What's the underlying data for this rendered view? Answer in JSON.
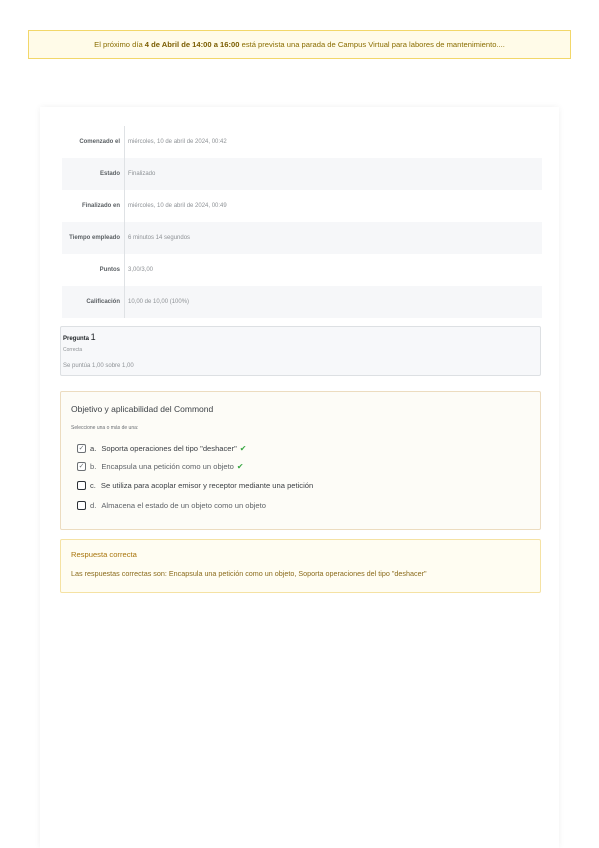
{
  "notice": {
    "pre": "El próximo día ",
    "bold": "4 de Abril de 14:00 a 16:00",
    "post": " está prevista una parada de Campus Virtual para labores de mantenimiento...."
  },
  "summary": [
    {
      "label": "Comenzado el",
      "value": "miércoles, 10 de abril de 2024, 00:42"
    },
    {
      "label": "Estado",
      "value": "Finalizado"
    },
    {
      "label": "Finalizado en",
      "value": "miércoles, 10 de abril de 2024, 00:49"
    },
    {
      "label": "Tiempo empleado",
      "value": "6 minutos 14 segundos"
    },
    {
      "label": "Puntos",
      "value": "3,00/3,00"
    },
    {
      "label": "Calificación",
      "value": "10,00 de 10,00 (100%)"
    }
  ],
  "question": {
    "title_prefix": "Pregunta ",
    "number": "1",
    "state": "Correcta",
    "grade": "Se puntúa 1,00 sobre 1,00",
    "text": "Objetivo y aplicabilidad del Commond",
    "prompt": "Seleccione una o más de una:",
    "options": [
      {
        "letter": "a.",
        "text": "Soporta operaciones del tipo \"deshacer\"",
        "checked": true,
        "correct": true
      },
      {
        "letter": "b.",
        "text": "Encapsula una petición como un objeto",
        "checked": true,
        "correct": true
      },
      {
        "letter": "c.",
        "text": "Se utiliza para acoplar emisor y receptor mediante una petición",
        "checked": false,
        "correct": false
      },
      {
        "letter": "d.",
        "text": "Almacena el estado de un objeto como un objeto",
        "checked": false,
        "correct": false
      }
    ]
  },
  "feedback": {
    "status": "Respuesta correcta",
    "answer": "Las respuestas correctas son: Encapsula una petición como un objeto, Soporta operaciones del tipo \"deshacer\""
  },
  "icons": {
    "checkmark": "check-icon",
    "correct": "green-tick-icon"
  },
  "colors": {
    "notice_bg": "#fffbe8",
    "notice_text": "#8a6d00",
    "correct_tick": "#3aa845",
    "feedback_text": "#a8740a"
  }
}
